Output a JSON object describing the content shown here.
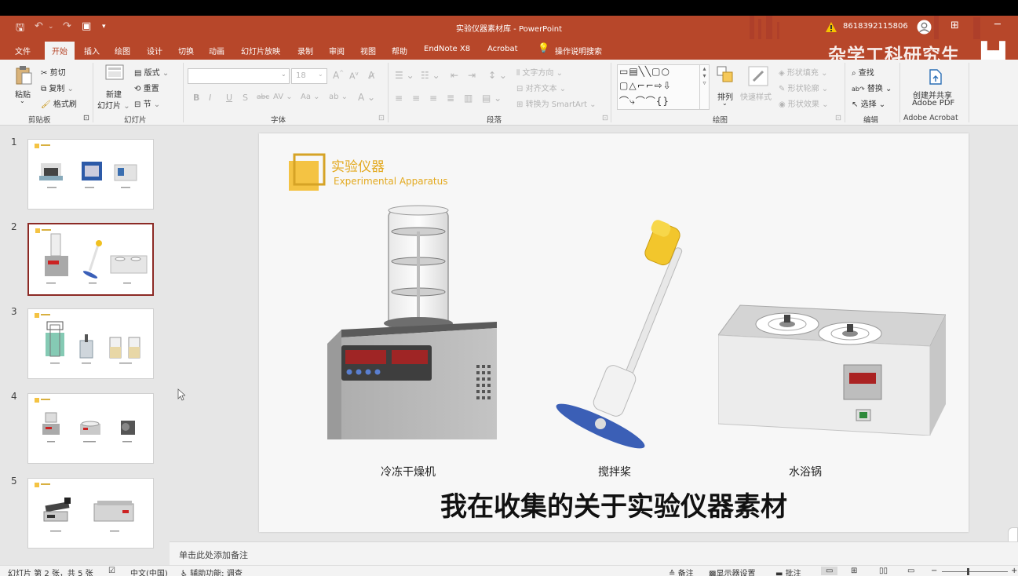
{
  "window": {
    "title": "实验仪器素材库 - PowerPoint",
    "account": "8618392115806",
    "watermark": "杂学工科研究生"
  },
  "colors": {
    "brand": "#b7472a",
    "ribbon_bg": "#f3f3f3",
    "slide_accent": "#f4c343",
    "thumb_selected": "#8c2a25"
  },
  "tabs": [
    "文件",
    "开始",
    "插入",
    "绘图",
    "设计",
    "切换",
    "动画",
    "幻灯片放映",
    "录制",
    "审阅",
    "视图",
    "帮助",
    "EndNote X8",
    "Acrobat"
  ],
  "active_tab": "开始",
  "tell_me": "操作说明搜索",
  "ribbon": {
    "clipboard": {
      "paste": "粘贴",
      "cut": "剪切",
      "copy": "复制",
      "format_painter": "格式刷",
      "group": "剪贴板"
    },
    "slides": {
      "new_slide_1": "新建",
      "new_slide_2": "幻灯片",
      "layout": "版式",
      "reset": "重置",
      "section": "节",
      "group": "幻灯片"
    },
    "font": {
      "size": "18",
      "group": "字体"
    },
    "paragraph": {
      "text_direction": "文字方向",
      "align_text": "对齐文本",
      "smartart": "转换为 SmartArt",
      "group": "段落"
    },
    "drawing": {
      "arrange": "排列",
      "quick_styles": "快速样式",
      "shape_fill": "形状填充",
      "shape_outline": "形状轮廓",
      "shape_effects": "形状效果",
      "group": "绘图"
    },
    "editing": {
      "find": "查找",
      "replace": "替换",
      "select": "选择",
      "group": "编辑"
    },
    "acrobat": {
      "create_1": "创建并共享",
      "create_2": "Adobe PDF",
      "group": "Adobe Acrobat"
    }
  },
  "thumbnails": [
    {
      "num": "1",
      "selected": false
    },
    {
      "num": "2",
      "selected": true
    },
    {
      "num": "3",
      "selected": false
    },
    {
      "num": "4",
      "selected": false
    },
    {
      "num": "5",
      "selected": false
    }
  ],
  "slide": {
    "title_cn": "实验仪器",
    "title_en": "Experimental Apparatus",
    "items": [
      "冷冻干燥机",
      "搅拌桨",
      "水浴锅"
    ],
    "caption": "我在收集的关于实验仪器素材"
  },
  "notes_placeholder": "单击此处添加备注",
  "status": {
    "slide_info": "幻灯片 第 2 张，共 5 张",
    "language": "中文(中国)",
    "accessibility": "辅助功能: 调查",
    "notes": "备注",
    "display_settings": "显示器设置",
    "comments": "批注"
  }
}
